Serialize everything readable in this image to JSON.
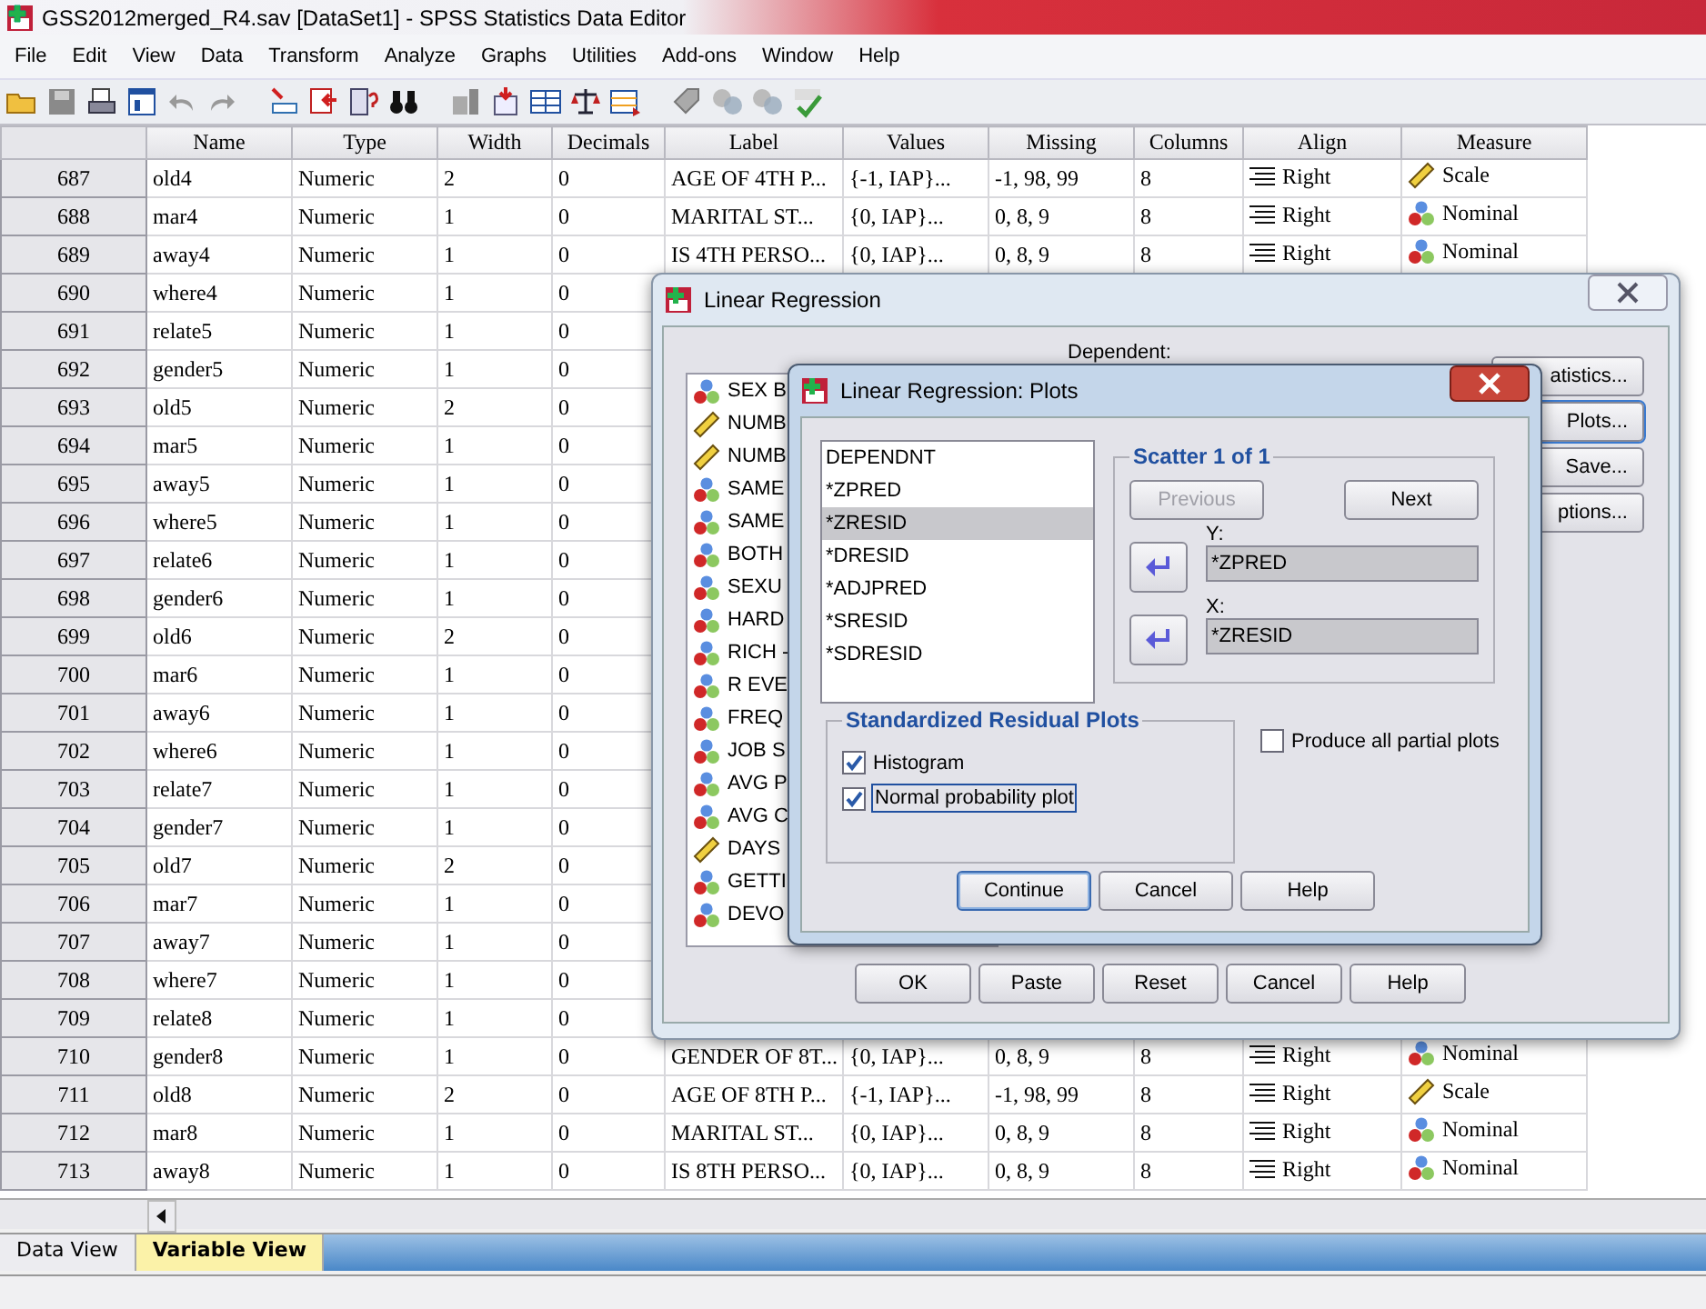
{
  "window": {
    "title": "GSS2012merged_R4.sav [DataSet1] - SPSS Statistics Data Editor"
  },
  "menu": [
    "File",
    "Edit",
    "View",
    "Data",
    "Transform",
    "Analyze",
    "Graphs",
    "Utilities",
    "Add-ons",
    "Window",
    "Help"
  ],
  "table": {
    "columns": [
      "Name",
      "Type",
      "Width",
      "Decimals",
      "Label",
      "Values",
      "Missing",
      "Columns",
      "Align",
      "Measure"
    ],
    "rows": [
      {
        "number": "687",
        "cells": [
          "old4",
          "Numeric",
          "2",
          "0",
          "AGE OF 4TH P...",
          "{-1, IAP}...",
          "-1, 98, 99",
          "8",
          "Right",
          "Scale"
        ],
        "kind": "scale"
      },
      {
        "number": "688",
        "cells": [
          "mar4",
          "Numeric",
          "1",
          "0",
          "MARITAL ST...",
          "{0, IAP}...",
          "0, 8, 9",
          "8",
          "Right",
          "Nominal"
        ],
        "kind": "nominal"
      },
      {
        "number": "689",
        "cells": [
          "away4",
          "Numeric",
          "1",
          "0",
          "IS 4TH PERSO...",
          "{0, IAP}...",
          "0, 8, 9",
          "8",
          "Right",
          "Nominal"
        ],
        "kind": "nominal"
      },
      {
        "number": "690",
        "cells": [
          "where4",
          "Numeric",
          "1",
          "0"
        ]
      },
      {
        "number": "691",
        "cells": [
          "relate5",
          "Numeric",
          "1",
          "0"
        ]
      },
      {
        "number": "692",
        "cells": [
          "gender5",
          "Numeric",
          "1",
          "0"
        ]
      },
      {
        "number": "693",
        "cells": [
          "old5",
          "Numeric",
          "2",
          "0"
        ]
      },
      {
        "number": "694",
        "cells": [
          "mar5",
          "Numeric",
          "1",
          "0"
        ]
      },
      {
        "number": "695",
        "cells": [
          "away5",
          "Numeric",
          "1",
          "0"
        ]
      },
      {
        "number": "696",
        "cells": [
          "where5",
          "Numeric",
          "1",
          "0"
        ]
      },
      {
        "number": "697",
        "cells": [
          "relate6",
          "Numeric",
          "1",
          "0"
        ]
      },
      {
        "number": "698",
        "cells": [
          "gender6",
          "Numeric",
          "1",
          "0"
        ]
      },
      {
        "number": "699",
        "cells": [
          "old6",
          "Numeric",
          "2",
          "0"
        ]
      },
      {
        "number": "700",
        "cells": [
          "mar6",
          "Numeric",
          "1",
          "0"
        ]
      },
      {
        "number": "701",
        "cells": [
          "away6",
          "Numeric",
          "1",
          "0"
        ]
      },
      {
        "number": "702",
        "cells": [
          "where6",
          "Numeric",
          "1",
          "0"
        ]
      },
      {
        "number": "703",
        "cells": [
          "relate7",
          "Numeric",
          "1",
          "0"
        ]
      },
      {
        "number": "704",
        "cells": [
          "gender7",
          "Numeric",
          "1",
          "0"
        ]
      },
      {
        "number": "705",
        "cells": [
          "old7",
          "Numeric",
          "2",
          "0"
        ]
      },
      {
        "number": "706",
        "cells": [
          "mar7",
          "Numeric",
          "1",
          "0"
        ]
      },
      {
        "number": "707",
        "cells": [
          "away7",
          "Numeric",
          "1",
          "0"
        ]
      },
      {
        "number": "708",
        "cells": [
          "where7",
          "Numeric",
          "1",
          "0"
        ]
      },
      {
        "number": "709",
        "cells": [
          "relate8",
          "Numeric",
          "1",
          "0"
        ]
      },
      {
        "number": "710",
        "cells": [
          "gender8",
          "Numeric",
          "1",
          "0",
          "GENDER OF 8T...",
          "{0, IAP}...",
          "0, 8, 9",
          "8",
          "Right",
          "Nominal"
        ],
        "kind": "nominal"
      },
      {
        "number": "711",
        "cells": [
          "old8",
          "Numeric",
          "2",
          "0",
          "AGE OF 8TH P...",
          "{-1, IAP}...",
          "-1, 98, 99",
          "8",
          "Right",
          "Scale"
        ],
        "kind": "scale"
      },
      {
        "number": "712",
        "cells": [
          "mar8",
          "Numeric",
          "1",
          "0",
          "MARITAL ST...",
          "{0, IAP}...",
          "0, 8, 9",
          "8",
          "Right",
          "Nominal"
        ],
        "kind": "nominal"
      },
      {
        "number": "713",
        "cells": [
          "away8",
          "Numeric",
          "1",
          "0",
          "IS 8TH PERSO...",
          "{0, IAP}...",
          "0, 8, 9",
          "8",
          "Right",
          "Nominal"
        ],
        "kind": "nominal"
      }
    ]
  },
  "tabs": [
    {
      "label": "Data View",
      "selected": false
    },
    {
      "label": "Variable View",
      "selected": true
    }
  ],
  "regression_dialog": {
    "title": "Linear Regression",
    "dependent_label": "Dependent:",
    "variables": [
      {
        "label": "SEX B",
        "kind": "nominal"
      },
      {
        "label": "NUMB",
        "kind": "scale"
      },
      {
        "label": "NUMB",
        "kind": "scale"
      },
      {
        "label": "SAME",
        "kind": "nominal"
      },
      {
        "label": "SAME",
        "kind": "nominal"
      },
      {
        "label": "BOTH",
        "kind": "nominal"
      },
      {
        "label": "SEXU",
        "kind": "nominal"
      },
      {
        "label": "HARD",
        "kind": "nominal"
      },
      {
        "label": "RICH -",
        "kind": "nominal"
      },
      {
        "label": "R EVE",
        "kind": "nominal"
      },
      {
        "label": "FREQ",
        "kind": "nominal"
      },
      {
        "label": "JOB S",
        "kind": "nominal"
      },
      {
        "label": "AVG P",
        "kind": "nominal"
      },
      {
        "label": "AVG C",
        "kind": "nominal"
      },
      {
        "label": "DAYS",
        "kind": "scale"
      },
      {
        "label": "GETTI",
        "kind": "nominal"
      },
      {
        "label": "DEVO",
        "kind": "nominal"
      }
    ],
    "side_buttons": [
      {
        "label": "atistics...",
        "focused": false
      },
      {
        "label": "Plots...",
        "focused": true
      },
      {
        "label": "Save...",
        "focused": false
      },
      {
        "label": "ptions...",
        "focused": false
      }
    ],
    "buttons": [
      "OK",
      "Paste",
      "Reset",
      "Cancel",
      "Help"
    ]
  },
  "plots_dialog": {
    "title": "Linear Regression: Plots",
    "variables": [
      {
        "label": "DEPENDNT",
        "selected": false
      },
      {
        "label": "*ZPRED",
        "selected": false
      },
      {
        "label": "*ZRESID",
        "selected": true
      },
      {
        "label": "*DRESID",
        "selected": false
      },
      {
        "label": "*ADJPRED",
        "selected": false
      },
      {
        "label": "*SRESID",
        "selected": false
      },
      {
        "label": "*SDRESID",
        "selected": false
      }
    ],
    "scatter": {
      "title": "Scatter 1 of 1",
      "previous": {
        "label": "Previous",
        "disabled": true
      },
      "next": {
        "label": "Next",
        "disabled": false
      },
      "y_label": "Y:",
      "y_value": "*ZPRED",
      "x_label": "X:",
      "x_value": "*ZRESID"
    },
    "residual_plots": {
      "title": "Standardized Residual Plots",
      "options": [
        {
          "label": "Histogram",
          "checked": true,
          "focused": false
        },
        {
          "label": "Normal probability plot",
          "checked": true,
          "focused": true
        }
      ]
    },
    "partial_plots": {
      "label": "Produce all partial plots",
      "checked": false
    },
    "buttons": [
      {
        "label": "Continue",
        "default": true
      },
      {
        "label": "Cancel",
        "default": false
      },
      {
        "label": "Help",
        "default": false
      }
    ]
  }
}
